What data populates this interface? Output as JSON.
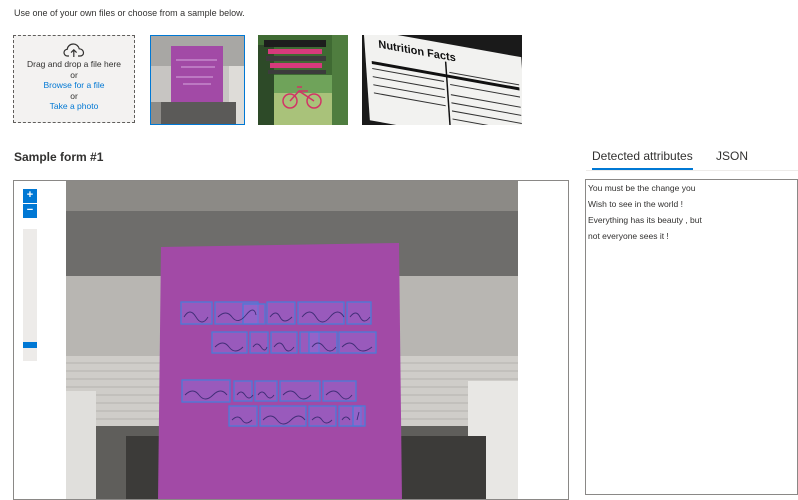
{
  "intro": "Use one of your own files or choose from a sample below.",
  "dropzone": {
    "line1": "Drag and drop a file here",
    "or1": "or",
    "browse": "Browse for a file",
    "or2": "or",
    "photo": "Take a photo"
  },
  "samples": [
    {
      "name": "Handwritten note sample",
      "selected": true
    },
    {
      "name": "Inspirational poster sample",
      "selected": false
    },
    {
      "name": "Nutrition facts sample",
      "selected": false
    }
  ],
  "form_title": "Sample form #1",
  "tabs": {
    "detected": "Detected attributes",
    "json": "JSON"
  },
  "viewer": {
    "zoom_in": "+",
    "zoom_out": "−",
    "zoom_level": 0.1
  },
  "detected_lines": [
    "You must be the change you",
    "Wish to see in the world !",
    "Everything has its beauty , but",
    "not everyone sees it !"
  ],
  "colors": {
    "accent": "#0078d4",
    "note": "#a24aa6",
    "box": "#4a7bd8"
  }
}
